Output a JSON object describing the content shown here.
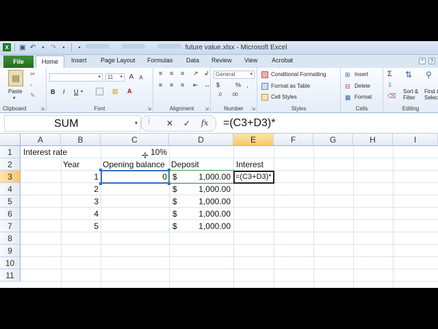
{
  "app": {
    "title": "future value.xlsx - Microsoft Excel"
  },
  "ribbon_tabs": [
    "File",
    "Home",
    "Insert",
    "Page Layout",
    "Formulas",
    "Data",
    "Review",
    "View",
    "Acrobat"
  ],
  "ribbon": {
    "clipboard": {
      "label": "Clipboard",
      "paste": "Paste"
    },
    "font": {
      "label": "Font",
      "size": "11"
    },
    "alignment": {
      "label": "Alignment"
    },
    "number": {
      "label": "Number",
      "format": "General"
    },
    "styles": {
      "label": "Styles",
      "conditional": "Conditional Formatting",
      "format_table": "Format as Table",
      "cell_styles": "Cell Styles"
    },
    "cells": {
      "label": "Cells",
      "insert": "Insert",
      "delete": "Delete",
      "format": "Format"
    },
    "editing": {
      "label": "Editing",
      "sort": "Sort &",
      "filter": "Filter",
      "find": "Find &",
      "select": "Selec"
    }
  },
  "formula_bar": {
    "name_box": "SUM",
    "formula": "=(C3+D3)*"
  },
  "columns": [
    "A",
    "B",
    "C",
    "D",
    "E",
    "F",
    "G",
    "H",
    "I"
  ],
  "rows": [
    "1",
    "2",
    "3",
    "4",
    "5",
    "6",
    "7",
    "8",
    "9",
    "10",
    "11"
  ],
  "cells": {
    "A1": "Interest rate",
    "C1": "10%",
    "B2": "Year",
    "C2": "Opening balance",
    "D2": "Deposit",
    "E2": "Interest",
    "B3": "1",
    "B4": "2",
    "B5": "3",
    "B6": "4",
    "B7": "5",
    "C3": "0",
    "D_currency": "$",
    "D3": "1,000.00",
    "D4": "1,000.00",
    "D5": "1,000.00",
    "D6": "1,000.00",
    "D7": "1,000.00",
    "E3_edit": "=(C3+D3)*"
  },
  "colors": {
    "file_tab": "#1f6e22",
    "selection_border": "#2f6fbf",
    "header_highlight": "#f8c86a"
  }
}
